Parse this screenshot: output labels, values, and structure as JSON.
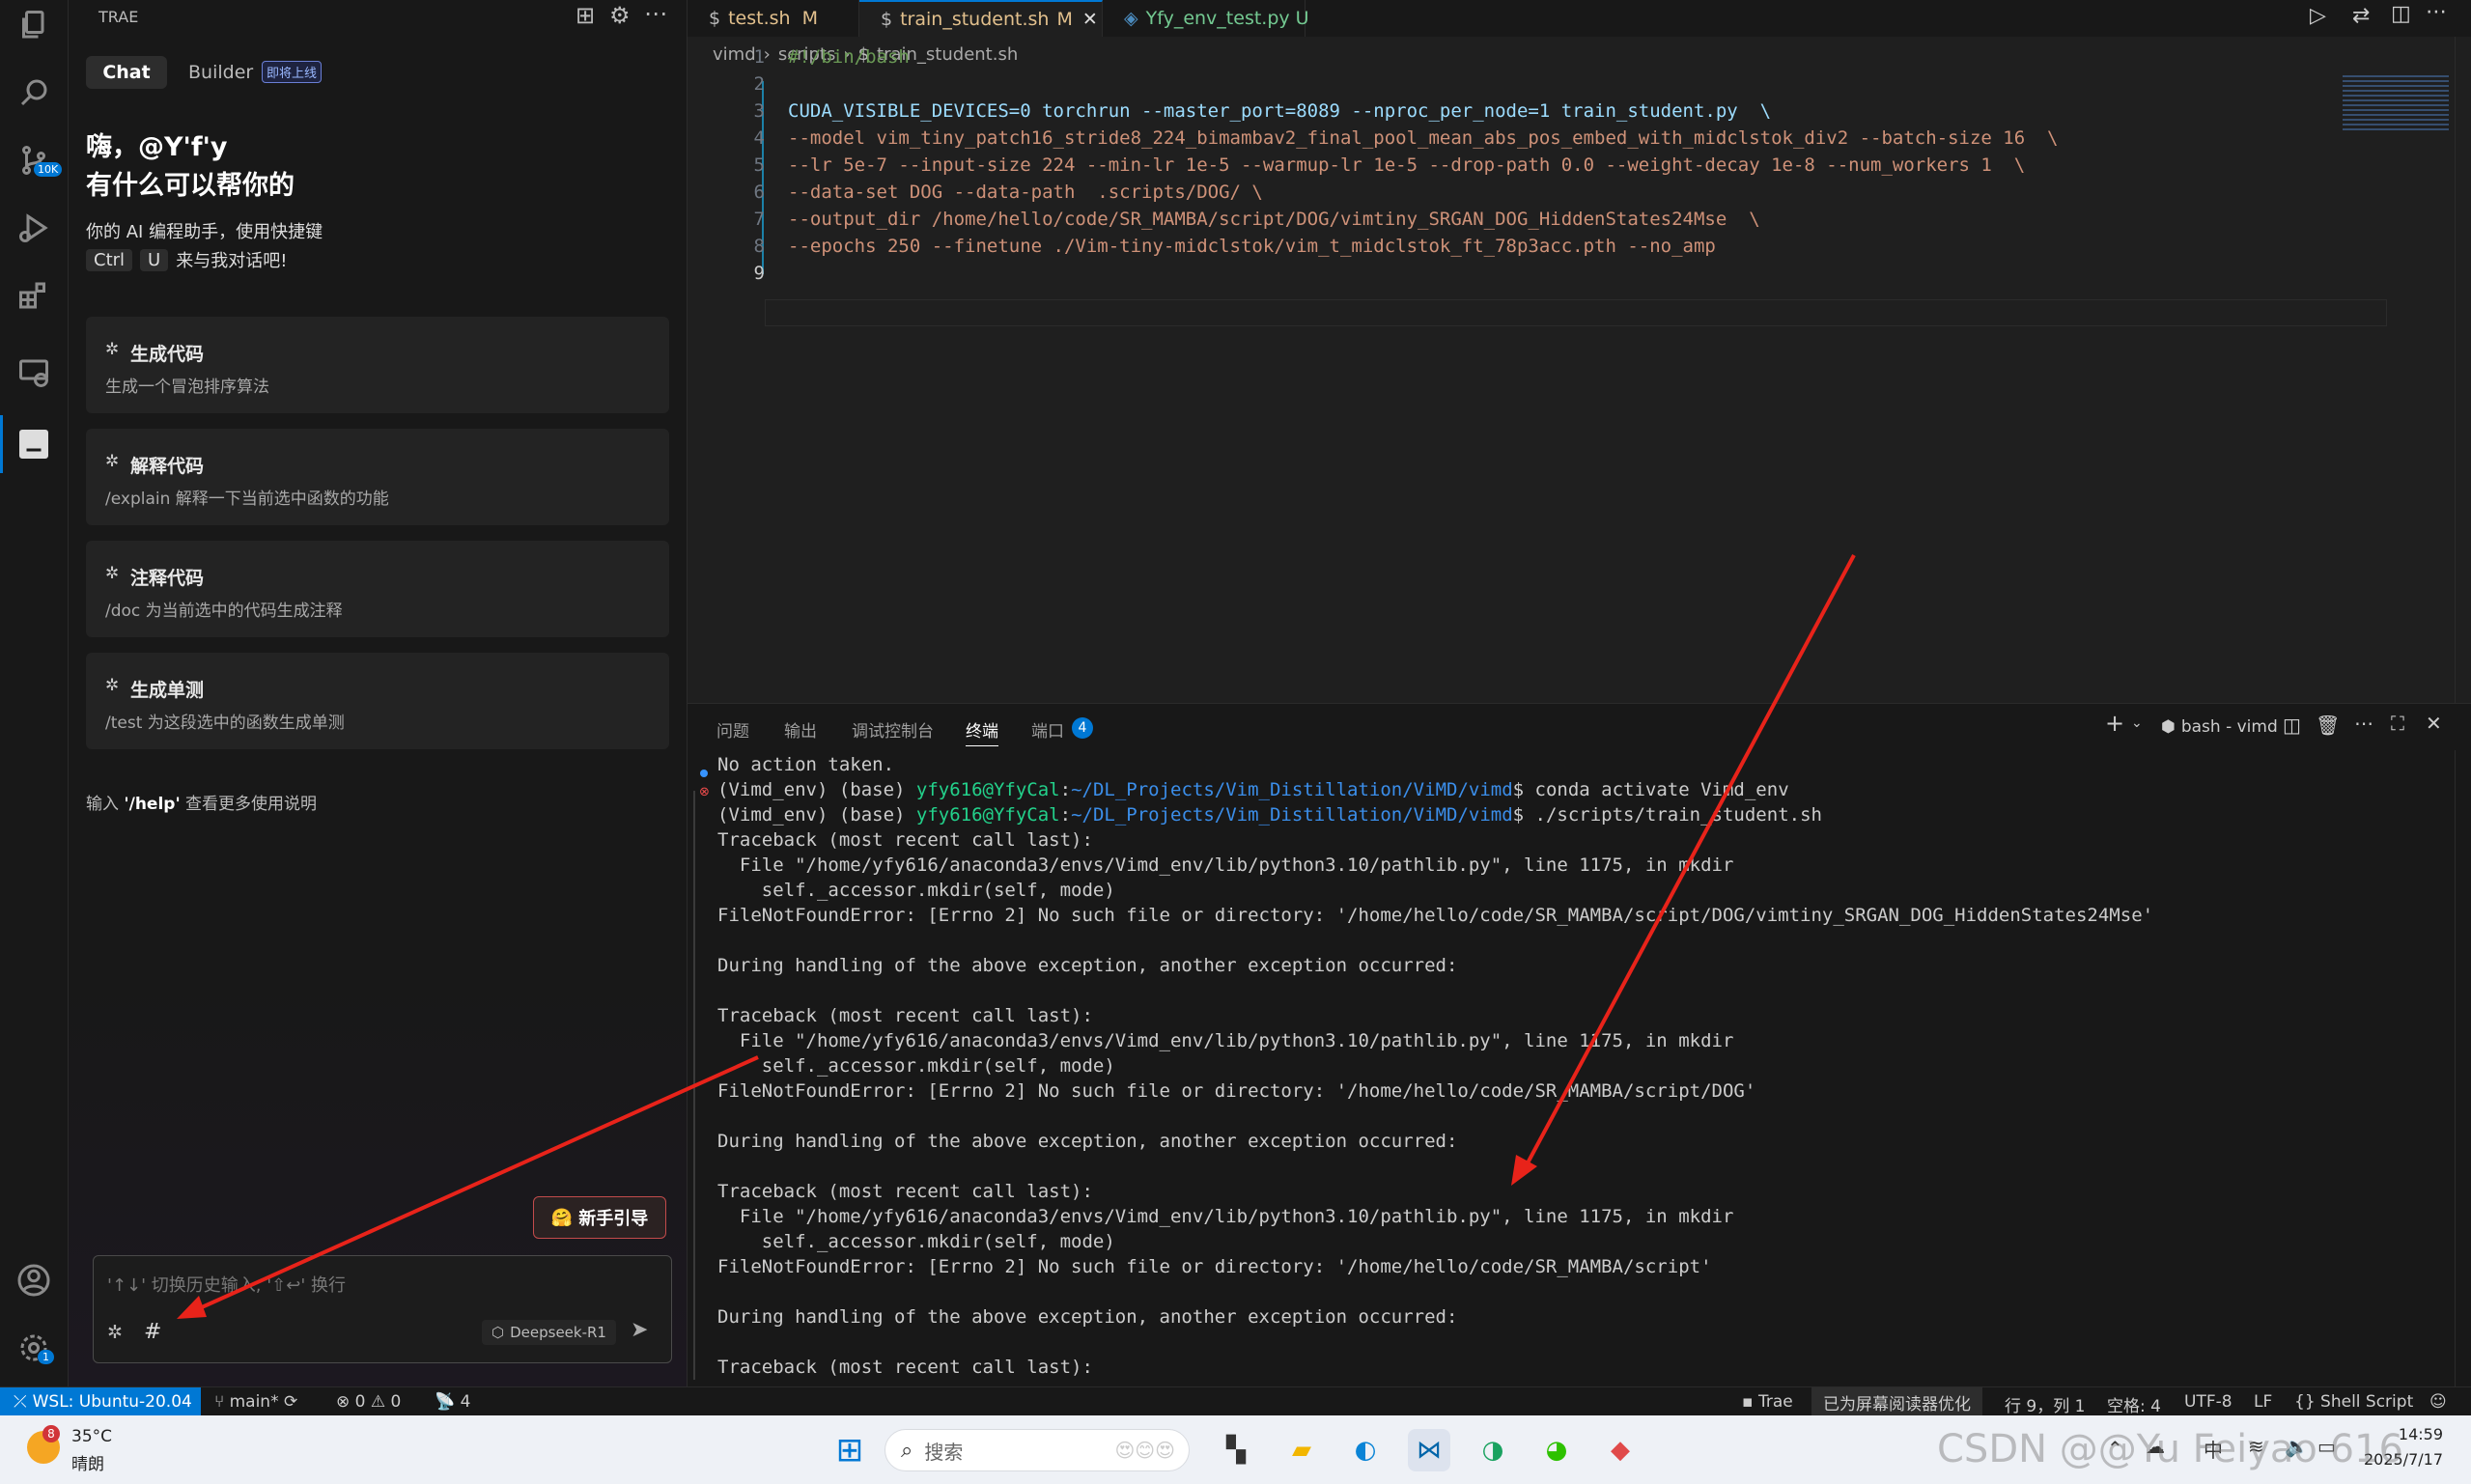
{
  "sidebar": {
    "title": "TRAE",
    "tab_chat": "Chat",
    "tab_builder": "Builder",
    "builder_badge": "即将上线",
    "greeting": "嗨，@Y'f'y",
    "subgreeting": "有什么可以帮你的",
    "desc1": "你的 AI 编程助手，使用快捷键",
    "key1": "Ctrl",
    "key2": "U",
    "desc2": "来与我对话吧!",
    "cards": [
      {
        "title": "生成代码",
        "desc": "生成一个冒泡排序算法"
      },
      {
        "title": "解释代码",
        "desc": "/explain 解释一下当前选中函数的功能"
      },
      {
        "title": "注释代码",
        "desc": "/doc 为当前选中的代码生成注释"
      },
      {
        "title": "生成单测",
        "desc": "/test 为这段选中的函数生成单测"
      }
    ],
    "help_pre": "输入 ",
    "help_cmd": "'/help'",
    "help_post": " 查看更多使用说明",
    "guide_button": "新手引导",
    "input_placeholder": "'↑↓' 切换历史输入, '⇧↩' 换行",
    "model": "Deepseek-R1",
    "hash": "#"
  },
  "tabs": [
    {
      "name": "test.sh",
      "status": "M"
    },
    {
      "name": "train_student.sh",
      "status": "M"
    },
    {
      "name": "Yfy_env_test.py",
      "status": "U"
    }
  ],
  "breadcrumb": {
    "a": "vimd",
    "b": "scripts",
    "c": "train_student.sh"
  },
  "code_lines": [
    {
      "n": "1",
      "text": "#!/bin/bash"
    },
    {
      "n": "2",
      "text": ""
    },
    {
      "n": "3",
      "text": "CUDA_VISIBLE_DEVICES=0 torchrun --master_port=8089 --nproc_per_node=1 train_student.py  \\"
    },
    {
      "n": "4",
      "text": "--model vim_tiny_patch16_stride8_224_bimambav2_final_pool_mean_abs_pos_embed_with_midclstok_div2 --batch-size 16  \\"
    },
    {
      "n": "5",
      "text": "--lr 5e-7 --input-size 224 --min-lr 1e-5 --warmup-lr 1e-5 --drop-path 0.0 --weight-decay 1e-8 --num_workers 1  \\"
    },
    {
      "n": "6",
      "text": "--data-set DOG --data-path  .scripts/DOG/ \\"
    },
    {
      "n": "7",
      "text": "--output_dir /home/hello/code/SR_MAMBA/script/DOG/vimtiny_SRGAN_DOG_HiddenStates24Mse  \\"
    },
    {
      "n": "8",
      "text": "--epochs 250 --finetune ./Vim-tiny-midclstok/vim_t_midclstok_ft_78p3acc.pth --no_amp"
    },
    {
      "n": "9",
      "text": ""
    }
  ],
  "panel": {
    "tabs": [
      "问题",
      "输出",
      "调试控制台",
      "终端",
      "端口"
    ],
    "port_count": "4",
    "shell": "bash - vimd",
    "lines": [
      "No action taken.",
      "(Vimd_env) (base) yfy616@YfyCal:~/DL_Projects/Vim_Distillation/ViMD/vimd$ conda activate Vimd_env",
      "(Vimd_env) (base) yfy616@YfyCal:~/DL_Projects/Vim_Distillation/ViMD/vimd$ ./scripts/train_student.sh",
      "Traceback (most recent call last):",
      "  File \"/home/yfy616/anaconda3/envs/Vimd_env/lib/python3.10/pathlib.py\", line 1175, in mkdir",
      "    self._accessor.mkdir(self, mode)",
      "FileNotFoundError: [Errno 2] No such file or directory: '/home/hello/code/SR_MAMBA/script/DOG/vimtiny_SRGAN_DOG_HiddenStates24Mse'",
      "",
      "During handling of the above exception, another exception occurred:",
      "",
      "Traceback (most recent call last):",
      "  File \"/home/yfy616/anaconda3/envs/Vimd_env/lib/python3.10/pathlib.py\", line 1175, in mkdir",
      "    self._accessor.mkdir(self, mode)",
      "FileNotFoundError: [Errno 2] No such file or directory: '/home/hello/code/SR_MAMBA/script/DOG'",
      "",
      "During handling of the above exception, another exception occurred:",
      "",
      "Traceback (most recent call last):",
      "  File \"/home/yfy616/anaconda3/envs/Vimd_env/lib/python3.10/pathlib.py\", line 1175, in mkdir",
      "    self._accessor.mkdir(self, mode)",
      "FileNotFoundError: [Errno 2] No such file or directory: '/home/hello/code/SR_MAMBA/script'",
      "",
      "During handling of the above exception, another exception occurred:",
      "",
      "Traceback (most recent call last):"
    ]
  },
  "status": {
    "remote": "WSL: Ubuntu-20.04",
    "branch": "main*",
    "errors": "0",
    "warnings": "0",
    "ports": "4",
    "trae": "Trae",
    "screen_reader": "已为屏幕阅读器优化",
    "position": "行 9，列 1",
    "spaces": "空格: 4",
    "encoding": "UTF-8",
    "eol": "LF",
    "language": "Shell Script"
  },
  "taskbar": {
    "weather_badge": "8",
    "temperature": "35°C",
    "weather": "晴朗",
    "search": "搜索",
    "ime": "中",
    "time": "14:59",
    "date": "2025/7/17",
    "watermark": "CSDN @@Yu Feiyao 616"
  },
  "activity_badges": {
    "scm": "10K",
    "settings": "1"
  },
  "colors": {
    "accent": "#0078d4",
    "red_arrow": "#e8231a",
    "status_remote": "#0078d4"
  }
}
